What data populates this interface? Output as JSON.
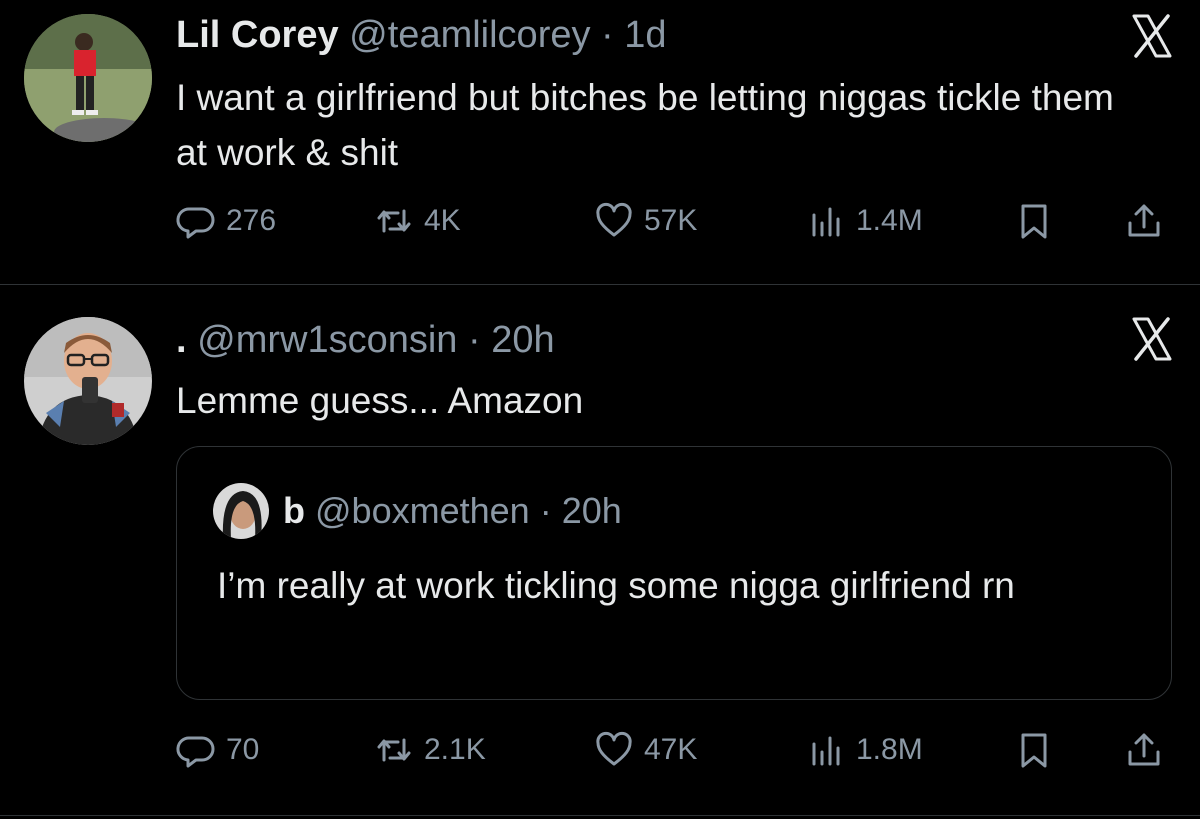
{
  "tweets": [
    {
      "name": "Lil Corey",
      "handle": "@teamlilcorey",
      "separator": "·",
      "time": "1d",
      "text": "I want a girlfriend but bitches be letting niggas tickle them at work & shit",
      "stats": {
        "replies": "276",
        "retweets": "4K",
        "likes": "57K",
        "views": "1.4M"
      }
    },
    {
      "name": ".",
      "handle": "@mrw1sconsin",
      "separator": "·",
      "time": "20h",
      "text": "Lemme guess... Amazon",
      "stats": {
        "replies": "70",
        "retweets": "2.1K",
        "likes": "47K",
        "views": "1.8M"
      },
      "quote": {
        "name": "b",
        "handle": "@boxmethen",
        "separator": "·",
        "time": "20h",
        "text": "I’m really at work tickling some nigga girlfriend rn"
      }
    }
  ],
  "icons": {
    "brand": "x-logo-icon",
    "reply": "reply-icon",
    "retweet": "retweet-icon",
    "like": "heart-icon",
    "views": "views-icon",
    "bookmark": "bookmark-icon",
    "share": "share-icon"
  },
  "colors": {
    "background": "#000000",
    "text": "#e7e9ea",
    "secondary_text": "#8b98a5",
    "border": "#2f3336"
  }
}
